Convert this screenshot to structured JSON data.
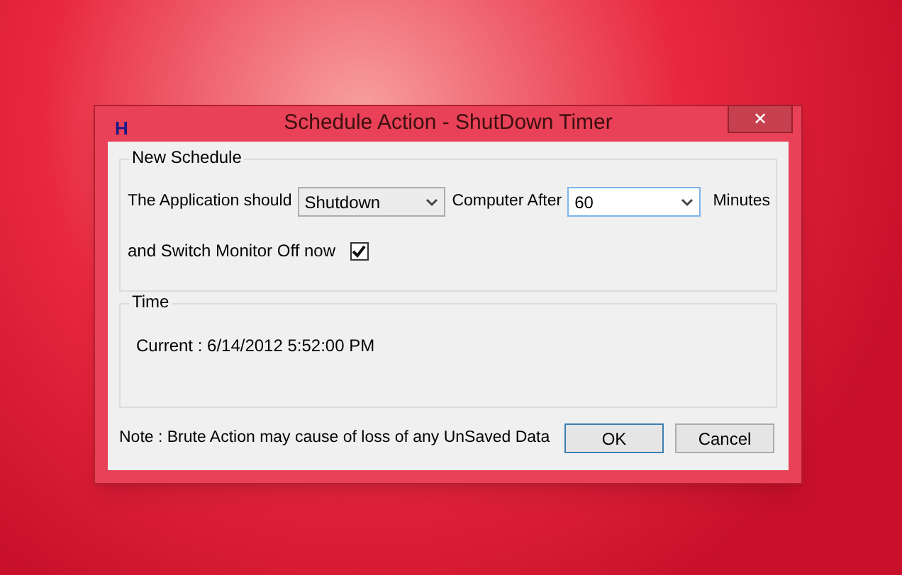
{
  "window": {
    "icon_letter": "H",
    "title": "Schedule Action - ShutDown Timer",
    "close": "✕"
  },
  "new_schedule": {
    "legend": "New Schedule",
    "label_before": "The Application should",
    "action": {
      "value": "Shutdown",
      "focused": false
    },
    "label_middle": "Computer After",
    "minutes": {
      "value": "60",
      "focused": true
    },
    "label_after": "Minutes",
    "monitor_label": "and Switch Monitor Off now",
    "monitor_checked": true
  },
  "time": {
    "legend": "Time",
    "current": "Current : 6/14/2012 5:52:00 PM"
  },
  "note": "Note : Brute Action may cause of loss of any UnSaved Data",
  "buttons": [
    {
      "label": "OK",
      "default": true
    },
    {
      "label": "Cancel",
      "default": false
    }
  ]
}
